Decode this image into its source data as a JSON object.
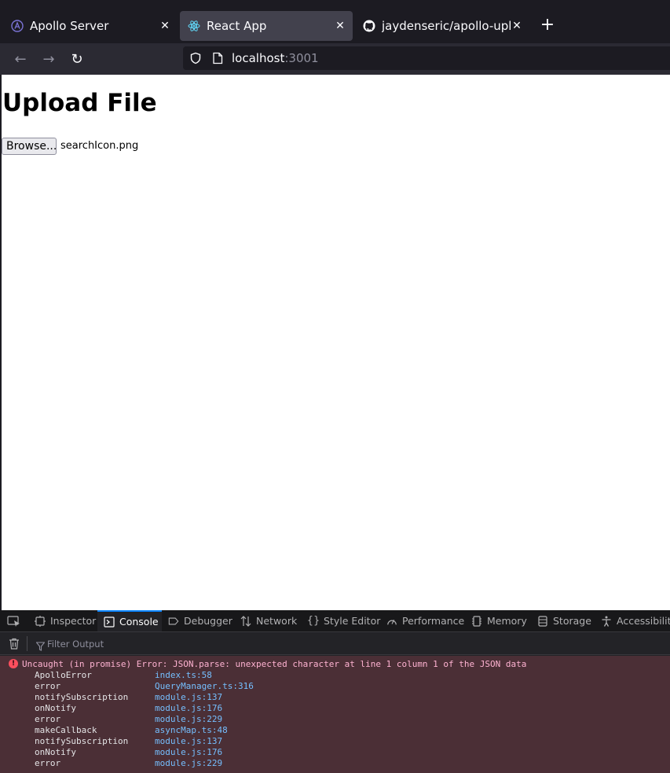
{
  "tabs": [
    {
      "title": "Apollo Server",
      "icon": "apollo-icon",
      "active": false
    },
    {
      "title": "React App",
      "icon": "react-icon",
      "active": true
    },
    {
      "title": "jaydenseric/apollo-upload",
      "icon": "github-icon",
      "active": false
    }
  ],
  "nav": {
    "url_host": "localhost",
    "url_port": ":3001"
  },
  "page": {
    "heading": "Upload File",
    "browse_label": "Browse...",
    "selected_file": "searchIcon.png"
  },
  "devtools": {
    "tabs": [
      "Inspector",
      "Console",
      "Debugger",
      "Network",
      "Style Editor",
      "Performance",
      "Memory",
      "Storage",
      "Accessibility"
    ],
    "selected_tab": "Console",
    "filter_placeholder": "Filter Output",
    "error_message": "Uncaught (in promise) Error: JSON.parse: unexpected character at line 1 column 1 of the JSON data",
    "stack": [
      {
        "fn": "ApolloError",
        "loc": "index.ts:58"
      },
      {
        "fn": "error",
        "loc": "QueryManager.ts:316"
      },
      {
        "fn": "notifySubscription",
        "loc": "module.js:137"
      },
      {
        "fn": "onNotify",
        "loc": "module.js:176"
      },
      {
        "fn": "error",
        "loc": "module.js:229"
      },
      {
        "fn": "makeCallback",
        "loc": "asyncMap.ts:48"
      },
      {
        "fn": "notifySubscription",
        "loc": "module.js:137"
      },
      {
        "fn": "onNotify",
        "loc": "module.js:176"
      },
      {
        "fn": "error",
        "loc": "module.js:229"
      }
    ]
  },
  "colors": {
    "accent": "#0a84ff",
    "error_bg": "#4b2f36",
    "link": "#75bfff"
  }
}
